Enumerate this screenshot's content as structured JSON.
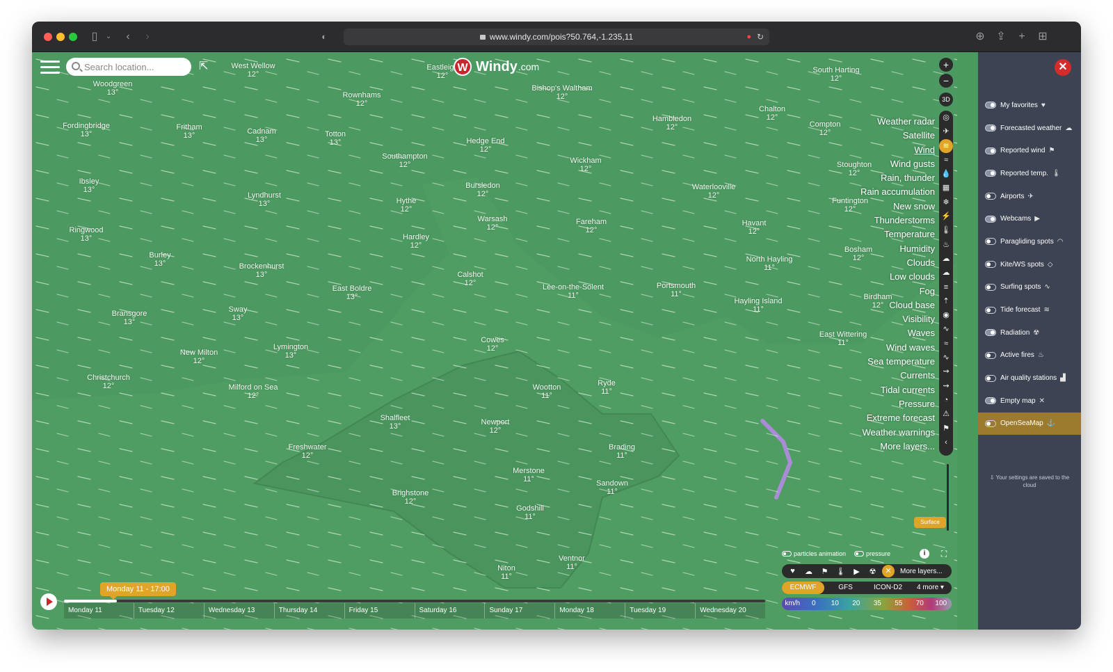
{
  "browser": {
    "url": "www.windy.com/pois?50.764,-1.235,11"
  },
  "map": {
    "search_placeholder": "Search location...",
    "logo_word": "Windy",
    "logo_domain": ".com",
    "places": [
      {
        "name": "Eastleigh",
        "temp": "12°"
      },
      {
        "name": "West Wellow",
        "temp": "12°"
      },
      {
        "name": "Woodgreen",
        "temp": "13°"
      },
      {
        "name": "Fordingbridge",
        "temp": "13°"
      },
      {
        "name": "Fritham",
        "temp": "13°"
      },
      {
        "name": "Cadnam",
        "temp": "13°"
      },
      {
        "name": "Totton",
        "temp": "13°"
      },
      {
        "name": "Rownhams",
        "temp": "12°"
      },
      {
        "name": "Bishop's Waltham",
        "temp": "12°"
      },
      {
        "name": "Southampton",
        "temp": "12°"
      },
      {
        "name": "Hedge End",
        "temp": "12°"
      },
      {
        "name": "Wickham",
        "temp": "12°"
      },
      {
        "name": "Hambledon",
        "temp": "12°"
      },
      {
        "name": "Chalton",
        "temp": "12°"
      },
      {
        "name": "Compton",
        "temp": "12°"
      },
      {
        "name": "South Harting",
        "temp": "12°"
      },
      {
        "name": "Ibsley",
        "temp": "13°"
      },
      {
        "name": "Lyndhurst",
        "temp": "13°"
      },
      {
        "name": "Hythe",
        "temp": "12°"
      },
      {
        "name": "Bursledon",
        "temp": "12°"
      },
      {
        "name": "Warsash",
        "temp": "12°"
      },
      {
        "name": "Waterlooville",
        "temp": "12°"
      },
      {
        "name": "Stoughton",
        "temp": "12°"
      },
      {
        "name": "Funtington",
        "temp": "12°"
      },
      {
        "name": "Ringwood",
        "temp": "13°"
      },
      {
        "name": "Hardley",
        "temp": "12°"
      },
      {
        "name": "Fareham",
        "temp": "12°"
      },
      {
        "name": "Havant",
        "temp": "12°"
      },
      {
        "name": "Burley",
        "temp": "13°"
      },
      {
        "name": "Brockenhurst",
        "temp": "13°"
      },
      {
        "name": "Calshot",
        "temp": "12°"
      },
      {
        "name": "Bosham",
        "temp": "12°"
      },
      {
        "name": "North Hayling",
        "temp": "11°"
      },
      {
        "name": "East Boldre",
        "temp": "13°"
      },
      {
        "name": "Lee-on-the-Solent",
        "temp": "11°"
      },
      {
        "name": "Portsmouth",
        "temp": "11°"
      },
      {
        "name": "Hayling Island",
        "temp": "11°"
      },
      {
        "name": "Birdham",
        "temp": "12°"
      },
      {
        "name": "Bransgore",
        "temp": "13°"
      },
      {
        "name": "Sway",
        "temp": "13°"
      },
      {
        "name": "East Wittering",
        "temp": "11°"
      },
      {
        "name": "Cowes",
        "temp": "12°"
      },
      {
        "name": "New Milton",
        "temp": "12°"
      },
      {
        "name": "Lymington",
        "temp": "13°"
      },
      {
        "name": "Christchurch",
        "temp": "12°"
      },
      {
        "name": "Milford on Sea",
        "temp": "12°"
      },
      {
        "name": "Wootton",
        "temp": "11°"
      },
      {
        "name": "Ryde",
        "temp": "11°"
      },
      {
        "name": "Shalfleet",
        "temp": "13°"
      },
      {
        "name": "Newport",
        "temp": "12°"
      },
      {
        "name": "Freshwater",
        "temp": "12°"
      },
      {
        "name": "Brading",
        "temp": "11°"
      },
      {
        "name": "Merstone",
        "temp": "11°"
      },
      {
        "name": "Sandown",
        "temp": "11°"
      },
      {
        "name": "Brighstone",
        "temp": "12°"
      },
      {
        "name": "Godshill",
        "temp": "11°"
      },
      {
        "name": "Ventnor",
        "temp": "11°"
      },
      {
        "name": "Niton",
        "temp": "11°"
      }
    ],
    "layers": [
      "Weather radar",
      "Satellite",
      "Wind",
      "Wind gusts",
      "Rain, thunder",
      "Rain accumulation",
      "New snow",
      "Thunderstorms",
      "Temperature",
      "Humidity",
      "Clouds",
      "Low clouds",
      "Fog",
      "Cloud base",
      "Visibility",
      "Waves",
      "Wind waves",
      "Sea temperature",
      "Currents",
      "Tidal currents",
      "Pressure",
      "Extreme forecast",
      "Weather warnings",
      "More layers..."
    ],
    "active_layer": "Wind",
    "three_d_label": "3D",
    "surface_label": "Surface",
    "particles_label": "particles animation",
    "pressure_label": "pressure",
    "more_layers_label": "More layers...",
    "models": [
      "ECMWF",
      "GFS",
      "ICON-D2",
      "4 more ▾"
    ],
    "selected_model": "ECMWF",
    "scale_unit": "km/h",
    "scale_values": [
      "0",
      "10",
      "20",
      "35",
      "55",
      "70",
      "100"
    ],
    "colors": {
      "accent": "#e0a429",
      "land": "#4a9a5e",
      "close": "#d42b2b"
    }
  },
  "timeline": {
    "current": "Monday 11 - 17:00",
    "progress": 0.075,
    "days": [
      "Monday 11",
      "Tuesday 12",
      "Wednesday 13",
      "Thursday 14",
      "Friday 15",
      "Saturday 16",
      "Sunday 17",
      "Monday 18",
      "Tuesday 19",
      "Wednesday 20"
    ]
  },
  "sidebar": {
    "options": [
      {
        "label": "My favorites",
        "on": true,
        "icon": "heart-icon"
      },
      {
        "label": "Forecasted weather",
        "on": true,
        "icon": "weather-icon"
      },
      {
        "label": "Reported wind",
        "on": true,
        "icon": "flag-icon"
      },
      {
        "label": "Reported temp.",
        "on": true,
        "icon": "thermometer-icon"
      },
      {
        "label": "Airports",
        "on": false,
        "icon": "plane-icon"
      },
      {
        "label": "Webcams",
        "on": true,
        "icon": "camera-icon"
      },
      {
        "label": "Paragliding spots",
        "on": false,
        "icon": "paraglider-icon"
      },
      {
        "label": "Kite/WS spots",
        "on": false,
        "icon": "kite-icon"
      },
      {
        "label": "Surfing spots",
        "on": false,
        "icon": "surfer-icon"
      },
      {
        "label": "Tide forecast",
        "on": false,
        "icon": "tide-icon"
      },
      {
        "label": "Radiation",
        "on": true,
        "icon": "radiation-icon"
      },
      {
        "label": "Active fires",
        "on": false,
        "icon": "fire-icon"
      },
      {
        "label": "Air quality stations",
        "on": false,
        "icon": "factory-icon"
      },
      {
        "label": "Empty map",
        "on": true,
        "icon": "x-icon"
      },
      {
        "label": "OpenSeaMap",
        "on": false,
        "icon": "anchor-icon"
      }
    ],
    "selected": "OpenSeaMap",
    "saved_note": "Your settings are saved to the cloud"
  }
}
